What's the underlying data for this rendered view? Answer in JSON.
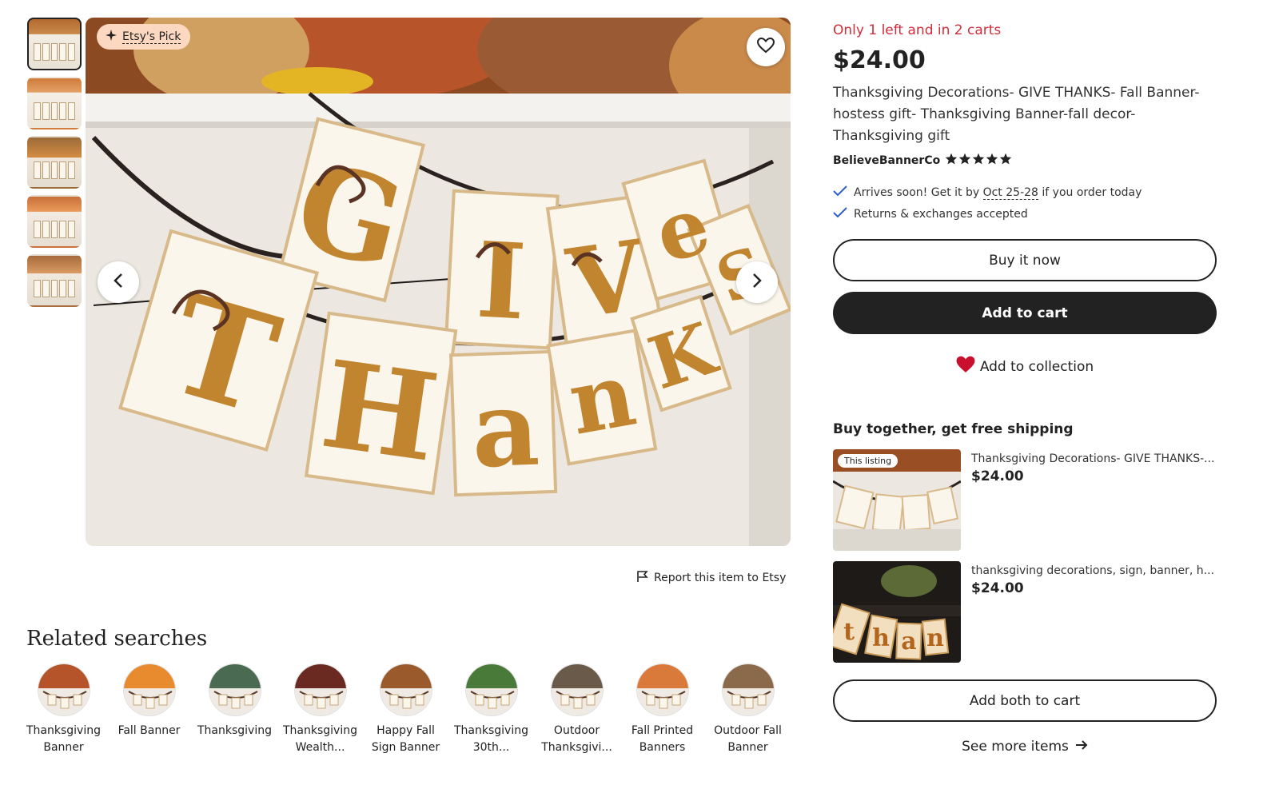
{
  "gallery": {
    "thumbnails": [
      "thumbnail-1",
      "thumbnail-2",
      "thumbnail-3",
      "thumbnail-4",
      "thumbnail-5"
    ],
    "active_index": 0,
    "badge": "Etsy's Pick",
    "letters_top": [
      "G",
      "I",
      "V",
      "e",
      "S"
    ],
    "letters_bottom": [
      "T",
      "H",
      "a",
      "n",
      "K"
    ],
    "report_label": "Report this item to Etsy"
  },
  "related": {
    "title": "Related searches",
    "items": [
      {
        "line1": "Thanksgiving",
        "line2": "Banner",
        "color": "#b5532a"
      },
      {
        "line1": "Fall Banner",
        "line2": "",
        "color": "#e88a2e"
      },
      {
        "line1": "Thanksgiving",
        "line2": "",
        "color": "#4b6a52"
      },
      {
        "line1": "Thanksgiving",
        "line2": "Wealth...",
        "color": "#6a2a22"
      },
      {
        "line1": "Happy Fall",
        "line2": "Sign Banner",
        "color": "#9a5a2c"
      },
      {
        "line1": "Thanksgiving",
        "line2": "30th...",
        "color": "#4a7a3a"
      },
      {
        "line1": "Outdoor",
        "line2": "Thanksgivi...",
        "color": "#6a5a4a"
      },
      {
        "line1": "Fall Printed",
        "line2": "Banners",
        "color": "#d97a3a"
      },
      {
        "line1": "Outdoor Fall",
        "line2": "Banner",
        "color": "#8a6a4a"
      }
    ]
  },
  "product": {
    "stock_notice": "Only 1 left and in 2 carts",
    "price": "$24.00",
    "title": "Thanksgiving Decorations- GIVE THANKS- Fall Banner-hostess gift- Thanksgiving Banner-fall decor- Thanksgiving gift",
    "shop_name": "BelieveBannerCo",
    "rating_stars": 5,
    "arrival_prefix": "Arrives soon! Get it by ",
    "arrival_dates": "Oct 25-28",
    "arrival_suffix": " if you order today",
    "returns": "Returns & exchanges accepted"
  },
  "actions": {
    "buy_now": "Buy it now",
    "add_to_cart": "Add to cart",
    "add_to_collection": "Add to collection"
  },
  "bundle": {
    "title": "Buy together, get free shipping",
    "this_listing_badge": "This listing",
    "items": [
      {
        "name": "Thanksgiving Decorations- GIVE THANKS-...",
        "price": "$24.00"
      },
      {
        "name": "thanksgiving decorations, sign, banner, h...",
        "price": "$24.00"
      }
    ],
    "add_both": "Add both to cart",
    "see_more": "See more items"
  },
  "colors": {
    "accent_red": "#d12c3a",
    "dark_button": "#222222",
    "heart_red": "#c8102e",
    "etsy_pick_bg": "#fdd8c1"
  }
}
